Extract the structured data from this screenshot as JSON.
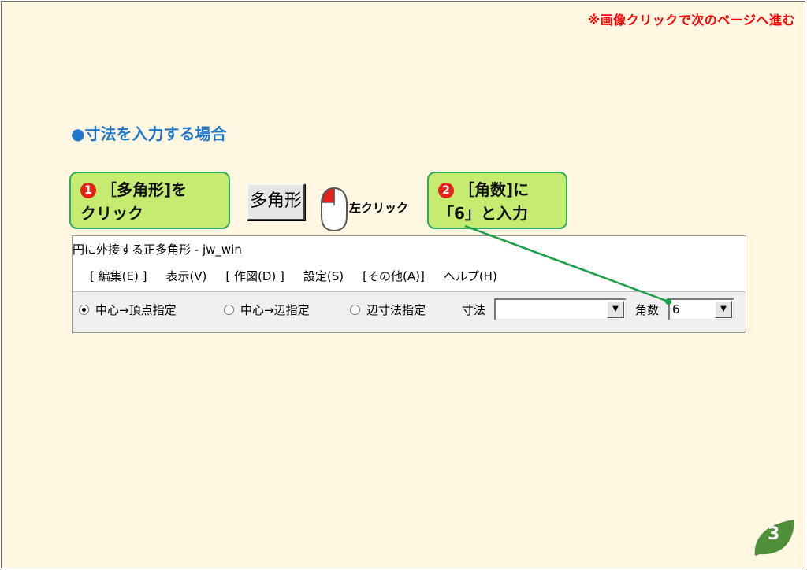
{
  "next_page_note": "※画像クリックで次のページへ進む",
  "heading": "●寸法を入力する場合",
  "callout1": {
    "num": "1",
    "line1": "［多角形]を",
    "line2": "クリック"
  },
  "callout2": {
    "num": "2",
    "line1": "［角数]に",
    "line2": "「6」と入力"
  },
  "tool_button": "多角形",
  "mouse_label": "左クリック",
  "window": {
    "title": "円に外接する正多角形 - jw_win",
    "menu": [
      "[ 編集(E) ]",
      "表示(V)",
      "[ 作図(D) ]",
      "設定(S)",
      "[その他(A)]",
      "ヘルプ(H)"
    ],
    "radio1": "中心→頂点指定",
    "radio2": "中心→辺指定",
    "radio3": "辺寸法指定",
    "dim_label": "寸法",
    "dim_value": "",
    "angle_label": "角数",
    "angle_value": "6"
  },
  "page_number": "3",
  "colors": {
    "accent": "#1f78c8",
    "callout_bg": "#c5ec70",
    "callout_border": "#2eaa58",
    "leaf": "#4f8f3a",
    "badge": "#e2231a"
  }
}
